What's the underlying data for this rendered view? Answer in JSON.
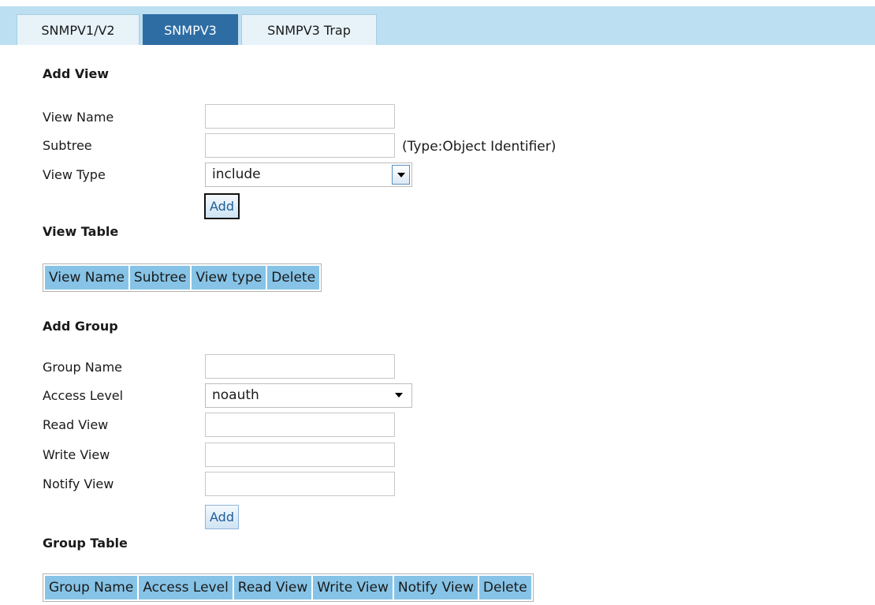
{
  "tabs": [
    {
      "label": "SNMPV1/V2",
      "active": false
    },
    {
      "label": "SNMPV3",
      "active": true
    },
    {
      "label": "SNMPV3 Trap",
      "active": false
    }
  ],
  "add_view": {
    "title": "Add View",
    "view_name_label": "View Name",
    "view_name_value": "",
    "subtree_label": "Subtree",
    "subtree_value": "",
    "subtree_hint": "(Type:Object Identifier)",
    "view_type_label": "View Type",
    "view_type_selected": "include",
    "add_button": "Add"
  },
  "view_table": {
    "title": "View Table",
    "columns": [
      "View Name",
      "Subtree",
      "View type",
      "Delete"
    ],
    "rows": []
  },
  "add_group": {
    "title": "Add Group",
    "group_name_label": "Group Name",
    "group_name_value": "",
    "access_level_label": "Access Level",
    "access_level_selected": "noauth",
    "read_view_label": "Read View",
    "read_view_value": "",
    "write_view_label": "Write View",
    "write_view_value": "",
    "notify_view_label": "Notify View",
    "notify_view_value": "",
    "add_button": "Add"
  },
  "group_table": {
    "title": "Group Table",
    "columns": [
      "Group Name",
      "Access Level",
      "Read View",
      "Write View",
      "Notify View",
      "Delete"
    ],
    "rows": []
  },
  "colors": {
    "tab_strip": "#bcdff1",
    "active_tab": "#2e6da4",
    "table_header": "#86c3e6",
    "button_text": "#1e5d99"
  }
}
